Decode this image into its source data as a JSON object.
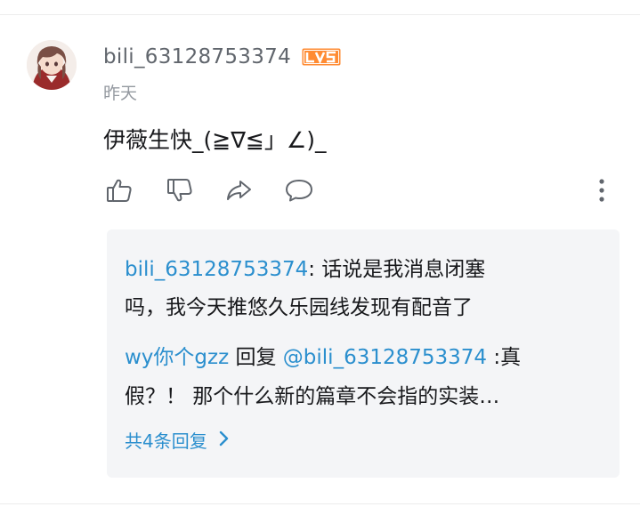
{
  "comment": {
    "username": "bili_63128753374",
    "level_badge": "LV5",
    "time": "昨天",
    "content": "伊薇生快_(≧∇≦」∠)_"
  },
  "actions": {
    "like_icon": "thumbs-up-icon",
    "dislike_icon": "thumbs-down-icon",
    "share_icon": "share-icon",
    "reply_icon": "comment-bubble-icon",
    "more_icon": "vertical-dots-icon"
  },
  "replies": [
    {
      "author": "bili_63128753374",
      "text_line1": ": 话说是我消息闭塞",
      "text_line2": "吗，我今天推悠久乐园线发现有配音了"
    },
    {
      "author": "wy你个gzz",
      "reply_word": " 回复 ",
      "mention": "@bili_63128753374",
      "text_line1": " :真",
      "text_line2": "假？！ 那个什么新的篇章不会指的实装…"
    }
  ],
  "more_replies_label": "共4条回复",
  "colors": {
    "link": "#2b8fce",
    "level_badge": "#ff8b33",
    "reply_bg": "#f4f5f7"
  }
}
